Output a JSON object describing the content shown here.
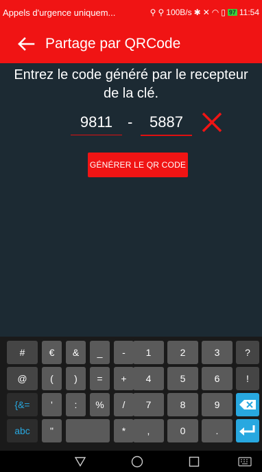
{
  "status_bar": {
    "carrier": "Appels d'urgence uniquem...",
    "speed": "100B/s",
    "battery": "97",
    "time": "11:54"
  },
  "app_bar": {
    "title": "Partage par QRCode",
    "back_icon": "arrow-left-icon"
  },
  "main": {
    "instruction_line1": "Entrez le code généré par le recepteur",
    "instruction_line2": "de la clé.",
    "code_part1": "9811",
    "separator": "-",
    "code_part2": "5887",
    "clear_icon": "close-x-icon",
    "generate_button": "GÉNÉRER LE QR CODE"
  },
  "colors": {
    "accent": "#f01414",
    "background": "#1c2a33",
    "keyboard_accent": "#28a8e0"
  },
  "keyboard": {
    "row1": [
      "#",
      "€",
      "&",
      "_",
      "-",
      "1",
      "2",
      "3",
      "?"
    ],
    "row2": [
      "@",
      "(",
      ")",
      "=",
      "+",
      "4",
      "5",
      "6",
      "!"
    ],
    "row3": [
      "{&=",
      "'",
      ":",
      "%",
      "/",
      "7",
      "8",
      "9",
      "backspace"
    ],
    "row4": [
      "abc",
      "\"",
      "",
      "*",
      ",",
      "0",
      ".",
      "enter"
    ]
  },
  "nav_bar": [
    "back-triangle-icon",
    "home-circle-icon",
    "recents-square-icon",
    "keyboard-switch-icon"
  ]
}
